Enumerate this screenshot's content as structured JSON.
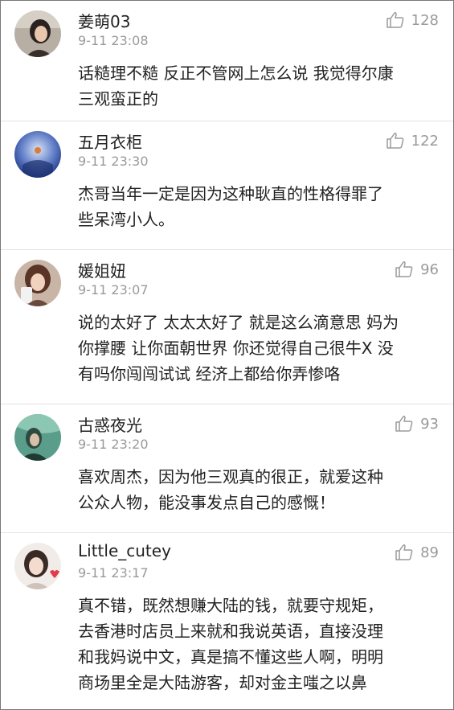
{
  "comments": [
    {
      "name": "姜萌03",
      "time": "9-11 23:08",
      "likes": "128",
      "lines": [
        "话糙理不糙 反正不管网上怎么说 我觉得尔康",
        "三观蛮正的"
      ],
      "avatar_icon": "avatar-photo-icon",
      "avatar_color": "#7a6a5c"
    },
    {
      "name": "五月衣柜",
      "time": "9-11 23:30",
      "likes": "122",
      "lines": [
        "杰哥当年一定是因为这种耿直的性格得罪了",
        "些呆湾小人。"
      ],
      "avatar_icon": "avatar-photo-icon",
      "avatar_color": "#3d5aa8"
    },
    {
      "name": "媛姐妞",
      "time": "9-11 23:07",
      "likes": "96",
      "lines": [
        "说的太好了 太太太好了 就是这么滴意思 妈为",
        "你撑腰 让你面朝世界 你还觉得自己很牛X 没",
        "有吗你闯闯试试 经济上都给你弄惨咯"
      ],
      "avatar_icon": "avatar-photo-icon",
      "avatar_color": "#8a5c48"
    },
    {
      "name": "古惑夜光",
      "time": "9-11 23:20",
      "likes": "93",
      "lines": [
        "喜欢周杰，因为他三观真的很正，就爱这种",
        "公众人物，能没事发点自己的感慨！"
      ],
      "avatar_icon": "avatar-photo-icon",
      "avatar_color": "#3f8a76"
    },
    {
      "name": "Little_cutey",
      "time": "9-11 23:17",
      "likes": "89",
      "lines": [
        "真不错，既然想赚大陆的钱，就要守规矩，",
        "去香港时店员上来就和我说英语，直接没理",
        "和我妈说中文，真是搞不懂这些人啊，明明",
        "商场里全是大陆游客，却对金主嗤之以鼻"
      ],
      "avatar_icon": "avatar-photo-icon",
      "avatar_color": "#d9c9c0"
    }
  ]
}
